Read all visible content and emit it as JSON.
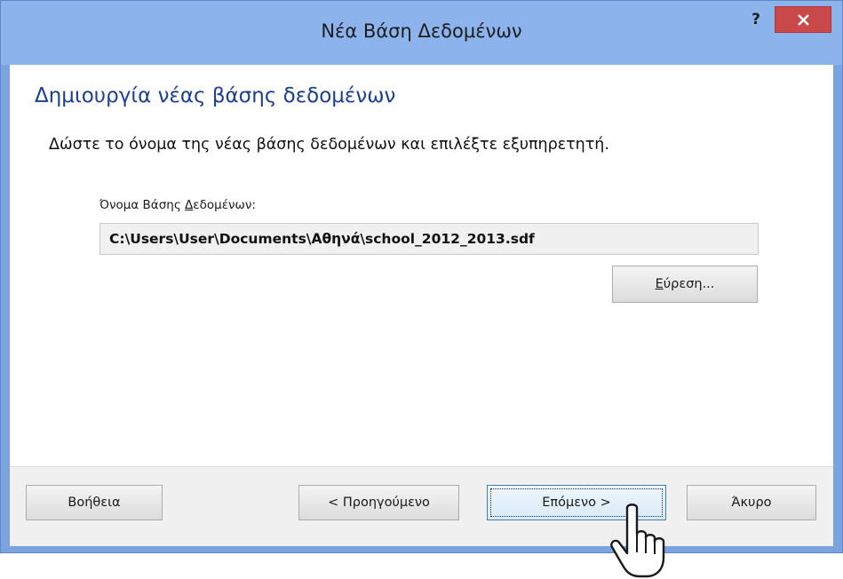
{
  "window": {
    "title": "Νέα Βάση Δεδομένων",
    "help_glyph": "?",
    "close_glyph": "×"
  },
  "content": {
    "heading": "Δημιουργία νέας βάσης δεδομένων",
    "instruction": "Δώστε το όνομα της νέας βάσης δεδομένων και επιλέξτε εξυπηρετητή.",
    "field_label_before": "Όνομα Βάσης ",
    "field_label_mnemonic": "Δ",
    "field_label_after": "εδομένων:",
    "database_path": "C:\\Users\\User\\Documents\\Αθηνά\\school_2012_2013.sdf",
    "browse_mnemonic": "Ε",
    "browse_rest": "ύρεση..."
  },
  "footer": {
    "help_label": "Βοήθεια",
    "prev_label": "< Προηγούμενο",
    "next_label": "Επόμενο >",
    "cancel_label": "Άκυρο"
  },
  "colors": {
    "title_bar": "#8db3ec",
    "close_button": "#c9484a",
    "heading_text": "#1a3f95"
  },
  "icons": {
    "close": "close-icon",
    "cursor": "hand-pointer-cursor-icon"
  }
}
